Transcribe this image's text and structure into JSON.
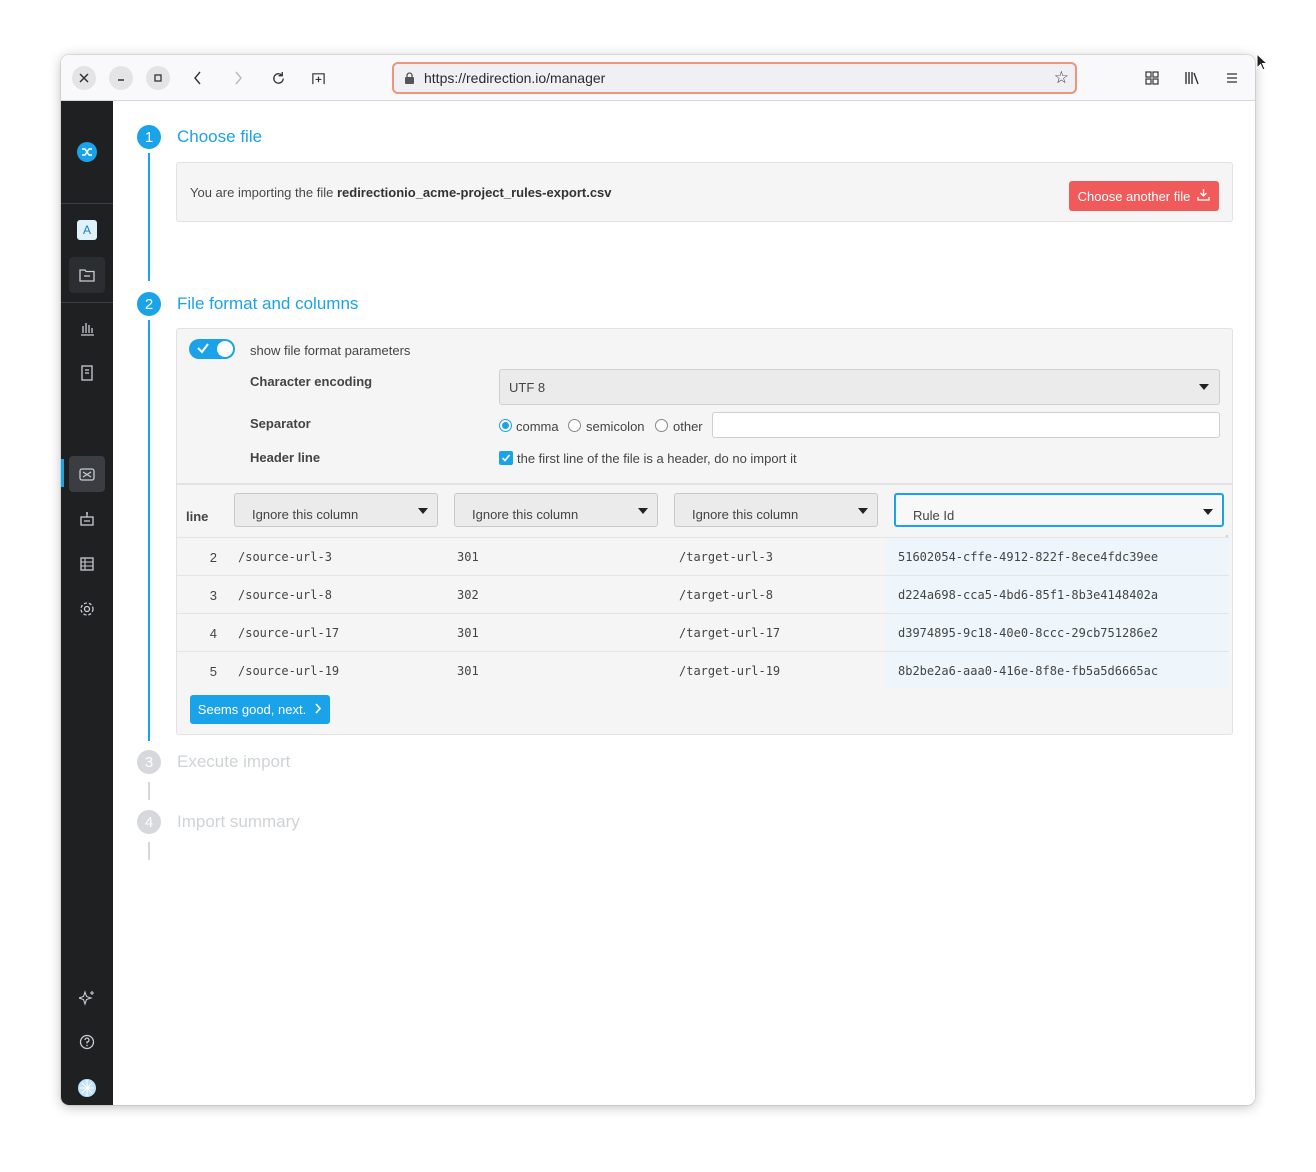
{
  "browser": {
    "url": "https://redirection.io/manager",
    "close_icon": "close-icon",
    "minimize_icon": "minimize-icon",
    "maximize_icon": "maximize-icon"
  },
  "sidebar": {
    "logo": "redirection-io-logo",
    "project_badge": "A",
    "items": [
      {
        "name": "projects-icon"
      },
      {
        "name": "analytics-icon"
      },
      {
        "name": "logs-icon"
      },
      {
        "name": "rules-icon",
        "active": true
      },
      {
        "name": "instances-icon"
      },
      {
        "name": "pages-icon"
      },
      {
        "name": "settings-icon"
      },
      {
        "name": "sparkles-icon"
      },
      {
        "name": "help-icon"
      },
      {
        "name": "language-icon"
      },
      {
        "name": "expand-icon"
      }
    ]
  },
  "steps": [
    {
      "number": "1",
      "title": "Choose file",
      "state": "done"
    },
    {
      "number": "2",
      "title": "File format and columns",
      "state": "active"
    },
    {
      "number": "3",
      "title": "Execute import",
      "state": "pending"
    },
    {
      "number": "4",
      "title": "Import summary",
      "state": "pending"
    }
  ],
  "choose_file": {
    "prefix": "You are importing the file",
    "filename": "redirectionio_acme-project_rules-export.csv",
    "button_label": "Choose another file"
  },
  "format": {
    "toggle_label": "show file format parameters",
    "toggle_on": true,
    "encoding_label": "Character encoding",
    "encoding_value": "UTF 8",
    "separator_label": "Separator",
    "separator_options": [
      "comma",
      "semicolon",
      "other"
    ],
    "separator_selected": "comma",
    "other_value": "",
    "header_label": "Header line",
    "header_checkbox_label": "the first line of the file is a header, do no import it",
    "header_checked": true
  },
  "table": {
    "line_header": "line",
    "columns": [
      "Ignore this column",
      "Ignore this column",
      "Ignore this column",
      "Rule Id"
    ],
    "rows": [
      {
        "line": "2",
        "c1": "/source-url-3",
        "c2": "301",
        "c3": "/target-url-3",
        "c4": "51602054-cffe-4912-822f-8ece4fdc39ee"
      },
      {
        "line": "3",
        "c1": "/source-url-8",
        "c2": "302",
        "c3": "/target-url-8",
        "c4": "d224a698-cca5-4bd6-85f1-8b3e4148402a"
      },
      {
        "line": "4",
        "c1": "/source-url-17",
        "c2": "301",
        "c3": "/target-url-17",
        "c4": "d3974895-9c18-40e0-8ccc-29cb751286e2"
      },
      {
        "line": "5",
        "c1": "/source-url-19",
        "c2": "301",
        "c3": "/target-url-19",
        "c4": "8b2be2a6-aaa0-416e-8f8e-fb5a5d6665ac"
      }
    ],
    "next_button": "Seems good, next."
  },
  "colors": {
    "accent": "#1aa3e8",
    "danger": "#f15a5a",
    "sidebar_bg": "#1e2022"
  }
}
